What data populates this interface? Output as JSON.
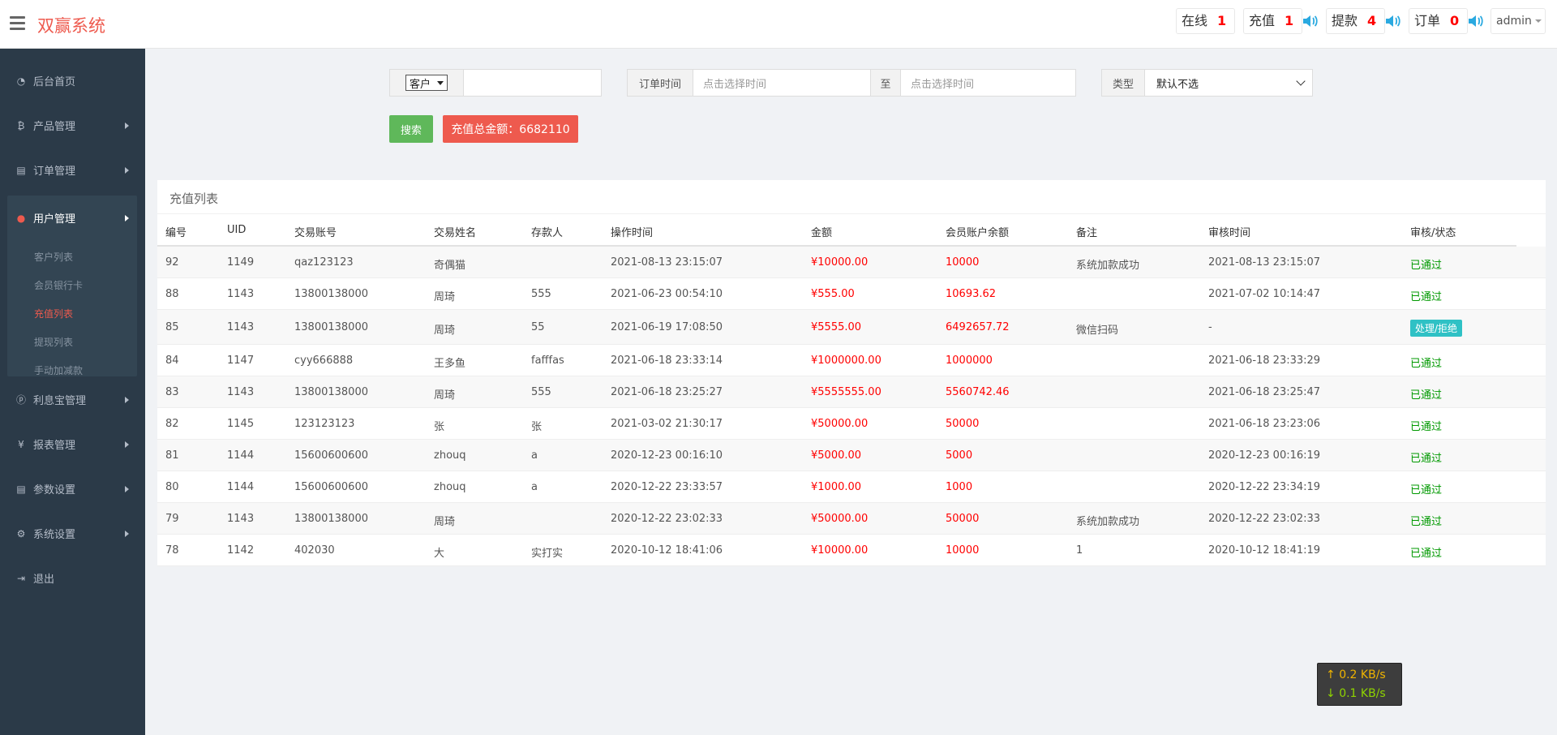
{
  "header": {
    "brand": "双赢系统",
    "stats": [
      {
        "label": "在线",
        "value": "1"
      },
      {
        "label": "充值",
        "value": "1"
      },
      {
        "label": "提款",
        "value": "4"
      },
      {
        "label": "订单",
        "value": "0"
      }
    ],
    "user": "admin"
  },
  "sidebar": {
    "items": [
      {
        "label": "后台首页",
        "icon": "dashboard-icon"
      },
      {
        "label": "产品管理",
        "icon": "bitcoin-icon"
      },
      {
        "label": "订单管理",
        "icon": "copy-icon"
      },
      {
        "label": "用户管理",
        "icon": "user-icon"
      },
      {
        "label": "利息宝管理",
        "icon": "pinterest-icon"
      },
      {
        "label": "报表管理",
        "icon": "yen-icon"
      },
      {
        "label": "参数设置",
        "icon": "copy-icon"
      },
      {
        "label": "系统设置",
        "icon": "gears-icon"
      },
      {
        "label": "退出",
        "icon": "sign-out-icon"
      }
    ],
    "subitems": [
      "客户列表",
      "会员银行卡",
      "充值列表",
      "提现列表",
      "手动加减款"
    ]
  },
  "filters": {
    "customer_select": "客户",
    "customer_value": "",
    "time_label": "订单时间",
    "time_start_placeholder": "点击选择时间",
    "time_sep": "至",
    "time_end_placeholder": "点击选择时间",
    "type_label": "类型",
    "type_value": "默认不选",
    "search_btn": "搜索",
    "total_btn": "充值总金额：6682110"
  },
  "table": {
    "title": "充值列表",
    "columns": [
      "编号",
      "UID",
      "交易账号",
      "交易姓名",
      "存款人",
      "操作时间",
      "金额",
      "会员账户余额",
      "备注",
      "审核时间",
      "审核/状态"
    ],
    "rows": [
      {
        "id": "92",
        "uid": "1149",
        "account": "qaz123123",
        "name": "奇偶猫",
        "depositor": "",
        "op_time": "2021-08-13 23:15:07",
        "amount": "¥10000.00",
        "balance": "10000",
        "note": "系统加款成功",
        "review_time": "2021-08-13 23:15:07",
        "status": "已通过"
      },
      {
        "id": "88",
        "uid": "1143",
        "account": "13800138000",
        "name": "周琦",
        "depositor": "555",
        "op_time": "2021-06-23 00:54:10",
        "amount": "¥555.00",
        "balance": "10693.62",
        "note": "",
        "review_time": "2021-07-02 10:14:47",
        "status": "已通过"
      },
      {
        "id": "85",
        "uid": "1143",
        "account": "13800138000",
        "name": "周琦",
        "depositor": "55",
        "op_time": "2021-06-19 17:08:50",
        "amount": "¥5555.00",
        "balance": "6492657.72",
        "note": "微信扫码",
        "review_time": "-",
        "status": "处理/拒绝"
      },
      {
        "id": "84",
        "uid": "1147",
        "account": "cyy666888",
        "name": "王多鱼",
        "depositor": "fafffas",
        "op_time": "2021-06-18 23:33:14",
        "amount": "¥1000000.00",
        "balance": "1000000",
        "note": "",
        "review_time": "2021-06-18 23:33:29",
        "status": "已通过"
      },
      {
        "id": "83",
        "uid": "1143",
        "account": "13800138000",
        "name": "周琦",
        "depositor": "555",
        "op_time": "2021-06-18 23:25:27",
        "amount": "¥5555555.00",
        "balance": "5560742.46",
        "note": "",
        "review_time": "2021-06-18 23:25:47",
        "status": "已通过"
      },
      {
        "id": "82",
        "uid": "1145",
        "account": "123123123",
        "name": "张",
        "depositor": "张",
        "op_time": "2021-03-02 21:30:17",
        "amount": "¥50000.00",
        "balance": "50000",
        "note": "",
        "review_time": "2021-06-18 23:23:06",
        "status": "已通过"
      },
      {
        "id": "81",
        "uid": "1144",
        "account": "15600600600",
        "name": "zhouq",
        "depositor": "a",
        "op_time": "2020-12-23 00:16:10",
        "amount": "¥5000.00",
        "balance": "5000",
        "note": "",
        "review_time": "2020-12-23 00:16:19",
        "status": "已通过"
      },
      {
        "id": "80",
        "uid": "1144",
        "account": "15600600600",
        "name": "zhouq",
        "depositor": "a",
        "op_time": "2020-12-22 23:33:57",
        "amount": "¥1000.00",
        "balance": "1000",
        "note": "",
        "review_time": "2020-12-22 23:34:19",
        "status": "已通过"
      },
      {
        "id": "79",
        "uid": "1143",
        "account": "13800138000",
        "name": "周琦",
        "depositor": "",
        "op_time": "2020-12-22 23:02:33",
        "amount": "¥50000.00",
        "balance": "50000",
        "note": "系统加款成功",
        "review_time": "2020-12-22 23:02:33",
        "status": "已通过"
      },
      {
        "id": "78",
        "uid": "1142",
        "account": "402030",
        "name": "大",
        "depositor": "实打实",
        "op_time": "2020-10-12 18:41:06",
        "amount": "¥10000.00",
        "balance": "10000",
        "note": "1",
        "review_time": "2020-10-12 18:41:19",
        "status": "已通过"
      }
    ]
  },
  "netspeed": {
    "up": "0.2 KB/s",
    "down": "0.1 KB/s"
  },
  "colors": {
    "accent": "#ee5a4e",
    "sidebar": "#2b3a48",
    "success": "#5fb85a",
    "status_ok": "#009900",
    "pending": "#2fc1c5"
  }
}
